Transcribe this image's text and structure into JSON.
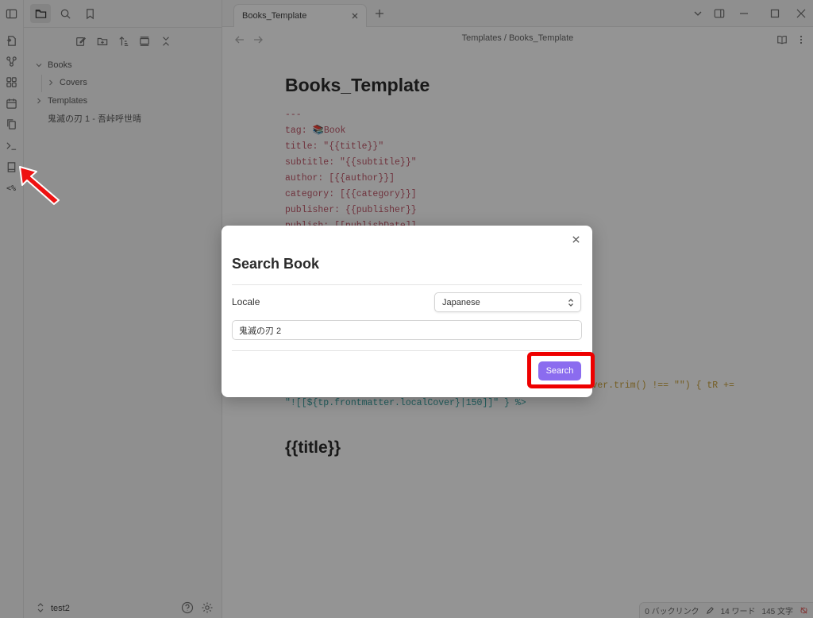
{
  "sidebar": {
    "tree": [
      {
        "label": "Books"
      },
      {
        "label": "Covers"
      },
      {
        "label": "Templates"
      },
      {
        "label": "鬼滅の刃 1 - 吾峠呼世晴"
      }
    ],
    "vault_name": "test2"
  },
  "tab": {
    "title": "Books_Template"
  },
  "breadcrumb": {
    "text": "Templates / Books_Template"
  },
  "note": {
    "title": "Books_Template",
    "frontmatter": [
      "---",
      "tag: 📚Book",
      "title: \"{{title}}\"",
      "subtitle: \"{{subtitle}}\"",
      "author: [{{author}}]",
      "category: [{{category}}]",
      "publisher: {{publisher}}",
      "publish: [[publishDate]]"
    ],
    "code_tail_1": "                                                       over.trim() !== \"\") { tR +=",
    "code_tail_2": "\"![[${tp.frontmatter.localCover}|150]]\" } %>",
    "heading": "{{title}}"
  },
  "status": {
    "backlinks": "0 バックリンク",
    "words": "14 ワード",
    "chars": "145 文字"
  },
  "modal": {
    "title": "Search Book",
    "locale_label": "Locale",
    "locale_value": "Japanese",
    "query_value": "鬼滅の刃 2",
    "search_label": "Search"
  },
  "colors": {
    "accent": "#8b6cef",
    "highlight": "#ee0000",
    "code_pink": "#c0586a"
  }
}
